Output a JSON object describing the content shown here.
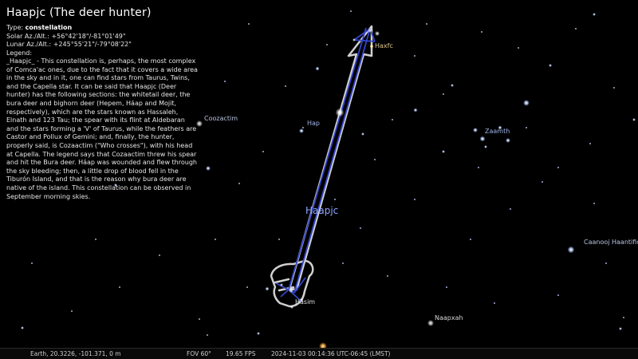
{
  "object": {
    "title": "Haapjc (The deer hunter)",
    "type_label": "Type: ",
    "type_value": "constellation",
    "solar": "Solar Az./Alt.: +56°42'18\"/-81°01'49\"",
    "lunar": "Lunar Az./Alt.: +245°55'21\"/-79°08'22\"",
    "legend_label": "Legend:",
    "legend_text": "_Haapjc_ - This constellation is, perhaps, the most complex of Comca'ac ones, due to the fact that it covers a wide area in the sky and in it, one can find stars from Taurus, Twins, and the Capella star. It can be said that Haapjc (Deer hunter) has the following sections: the whitetail deer, the bura deer and bighorn deer (Hepem, Háap and Mojit, respectively), which are the stars known as Hassaleh, Elnath and 123 Tau; the spear with its flint at Aldebaran and the stars forming a 'V' of Taurus, while the feathers are Castor and Pollux of Gemini; and, finally, the hunter, properly said, is Cozaactim (\"Who crosses\"), with his head at Capella. The legend says that Cozaactim threw his spear and hit the Bura deer. Háap was wounded and flew through the sky bleeding; then, a little drop of blood fell in the Tiburón Island, and that is the reason why bura deer are native of the island. This constellation can be observed in September morning skies."
  },
  "sky_labels": {
    "constellation": "Haapjc",
    "haxfc": "Haxfc",
    "coozactim": "Coozactim",
    "hap": "Hap",
    "zaamth": "Zaamth",
    "caanooj": "Caanooj Haantific",
    "hasim": "Hasim",
    "naapxah": "Naapxah"
  },
  "status_bar": {
    "location": "Earth, 20.3226, -101.371, 0 m",
    "fov": "FOV 60°",
    "fps": "19.65 FPS",
    "datetime": "2024-11-03 00:14:36 UTC-06:45 (LMST)"
  },
  "colors": {
    "background": "#000000",
    "constellation_line": "#3344cc",
    "constellation_label": "#8fa6ff",
    "art_outline": "#d0d0d0",
    "star_label": "#b8c4e0"
  }
}
